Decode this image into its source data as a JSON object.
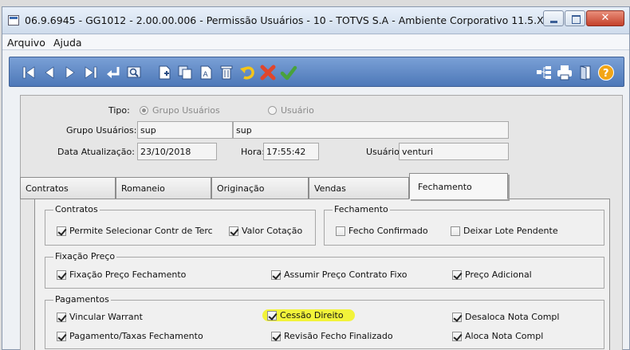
{
  "window": {
    "title": "06.9.6945 - GG1012 - 2.00.00.006 - Permissão Usuários - 10 - TOTVS S.A - Ambiente Corporativo 11.5.X ..."
  },
  "menu": {
    "items": [
      "Arquivo",
      "Ajuda"
    ]
  },
  "toolbar": {
    "left_icons": [
      "first-record-icon",
      "previous-record-icon",
      "next-record-icon",
      "last-record-icon",
      "enter-icon",
      "search-icon",
      "new-document-icon",
      "copy-icon",
      "text-edit-icon",
      "delete-icon",
      "undo-icon",
      "cancel-icon",
      "confirm-icon"
    ],
    "right_icons": [
      "tree-icon",
      "print-icon",
      "exit-icon",
      "help-icon"
    ],
    "colors": {
      "background": "#5f87c6",
      "cancel": "#e0462c",
      "confirm": "#49a23c",
      "undo": "#e2b514",
      "help": "#f2a516"
    }
  },
  "header": {
    "tipo_label": "Tipo:",
    "tipo_options": [
      "Grupo Usuários",
      "Usuário"
    ],
    "tipo_selected": "Grupo Usuários",
    "grupo_label": "Grupo Usuários:",
    "grupo_code": "sup",
    "grupo_desc": "sup",
    "data_label": "Data Atualização:",
    "data_value": "23/10/2018",
    "hora_label": "Hora:",
    "hora_value": "17:55:42",
    "usuario_label": "Usuário:",
    "usuario_value": "venturi"
  },
  "tabs": [
    "Contratos",
    "Romaneio",
    "Originação",
    "Vendas",
    "Fechamento"
  ],
  "active_tab": "Fechamento",
  "groups": {
    "contratos": {
      "title": "Contratos",
      "items": [
        {
          "label": "Permite Selecionar Contr de Terc",
          "checked": true
        },
        {
          "label": "Valor Cotação",
          "checked": true
        }
      ]
    },
    "fechamento": {
      "title": "Fechamento",
      "items": [
        {
          "label": "Fecho Confirmado",
          "checked": false
        },
        {
          "label": "Deixar Lote Pendente",
          "checked": false
        }
      ]
    },
    "fixacao": {
      "title": "Fixação Preço",
      "items": [
        {
          "label": "Fixação Preço Fechamento",
          "checked": true
        },
        {
          "label": "Assumir Preço Contrato Fixo",
          "checked": true
        },
        {
          "label": "Preço Adicional",
          "checked": true
        }
      ]
    },
    "pagamentos": {
      "title": "Pagamentos",
      "items": [
        {
          "label": "Vincular Warrant",
          "checked": true
        },
        {
          "label": "Cessão Direito",
          "checked": true,
          "highlight": "#f2f33a"
        },
        {
          "label": "Desaloca Nota Compl",
          "checked": true
        },
        {
          "label": "Pagamento/Taxas Fechamento",
          "checked": true
        },
        {
          "label": "Revisão Fecho Finalizado",
          "checked": true
        },
        {
          "label": "Aloca Nota Compl",
          "checked": true
        }
      ]
    }
  }
}
